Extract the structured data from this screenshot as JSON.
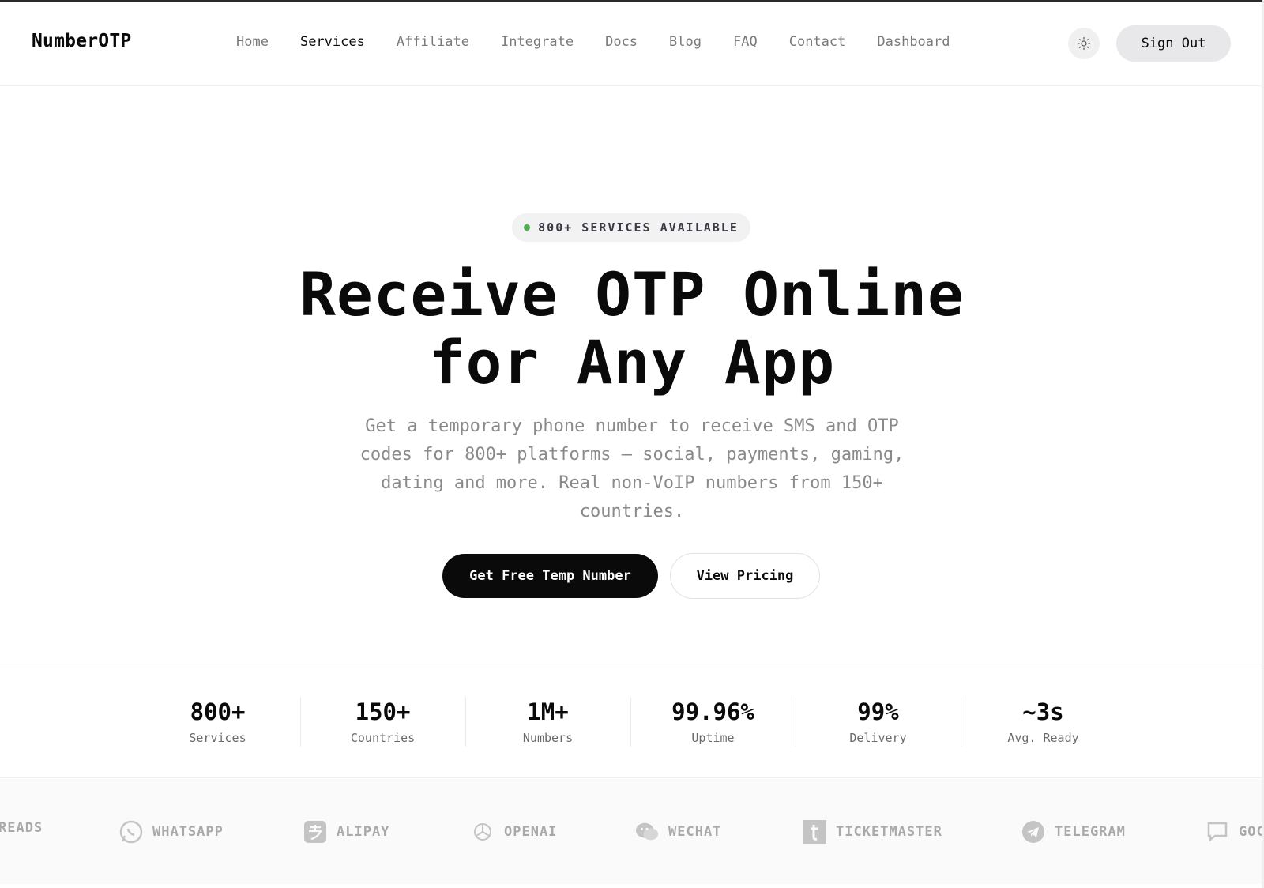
{
  "header": {
    "logo": "NumberOTP",
    "nav": [
      {
        "label": "Home",
        "active": false
      },
      {
        "label": "Services",
        "active": true
      },
      {
        "label": "Affiliate",
        "active": false
      },
      {
        "label": "Integrate",
        "active": false
      },
      {
        "label": "Docs",
        "active": false
      },
      {
        "label": "Blog",
        "active": false
      },
      {
        "label": "FAQ",
        "active": false
      },
      {
        "label": "Contact",
        "active": false
      },
      {
        "label": "Dashboard",
        "active": false
      }
    ],
    "theme_icon": "sun-icon",
    "signout_label": "Sign Out"
  },
  "hero": {
    "badge": "800+ SERVICES AVAILABLE",
    "headline_line1": "Receive OTP Online",
    "headline_line2": "for Any App",
    "subtitle": "Get a temporary phone number to receive SMS and OTP codes for 800+ platforms — social, payments, gaming, dating and more. Real non-VoIP numbers from 150+ countries.",
    "primary_cta": "Get Free Temp Number",
    "secondary_cta": "View Pricing"
  },
  "stats": [
    {
      "value": "800+",
      "label": "Services"
    },
    {
      "value": "150+",
      "label": "Countries"
    },
    {
      "value": "1M+",
      "label": "Numbers"
    },
    {
      "value": "99.96%",
      "label": "Uptime"
    },
    {
      "value": "99%",
      "label": "Delivery"
    },
    {
      "value": "~3s",
      "label": "Avg. Ready"
    }
  ],
  "brands": [
    {
      "name": "READS",
      "icon": "threads-icon"
    },
    {
      "name": "WHATSAPP",
      "icon": "whatsapp-icon"
    },
    {
      "name": "ALIPAY",
      "icon": "alipay-icon"
    },
    {
      "name": "OPENAI",
      "icon": "openai-icon"
    },
    {
      "name": "WECHAT",
      "icon": "wechat-icon"
    },
    {
      "name": "TICKETMASTER",
      "icon": "ticketmaster-icon"
    },
    {
      "name": "TELEGRAM",
      "icon": "telegram-icon"
    },
    {
      "name": "GOC",
      "icon": "google-chat-icon"
    }
  ],
  "colors": {
    "accent": "#0a0a0a",
    "badge_dot": "#4caf50",
    "muted_text": "#8a8a8a"
  }
}
